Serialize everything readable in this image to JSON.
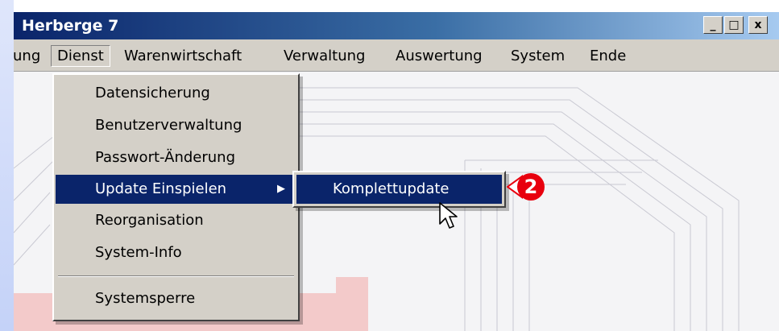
{
  "window": {
    "title": "Herberge 7",
    "controls": {
      "minimize": "_",
      "maximize": "□",
      "close": "x"
    }
  },
  "menubar": {
    "items": [
      {
        "label": "ung",
        "open": false
      },
      {
        "label": "Dienst",
        "open": true
      },
      {
        "label": "Warenwirtschaft",
        "open": false
      },
      {
        "label": "Verwaltung",
        "open": false
      },
      {
        "label": "Auswertung",
        "open": false
      },
      {
        "label": "System",
        "open": false
      },
      {
        "label": "Ende",
        "open": false
      }
    ]
  },
  "dienst_menu": {
    "items": [
      {
        "label": "Datensicherung"
      },
      {
        "label": "Benutzerverwaltung"
      },
      {
        "label": "Passwort-Änderung"
      },
      {
        "label": "Update Einspielen",
        "highlighted": true,
        "has_submenu": true
      },
      {
        "label": "Reorganisation"
      },
      {
        "label": "System-Info"
      },
      {
        "label": "Systemsperre"
      }
    ],
    "submenu_arrow": "▶"
  },
  "update_submenu": {
    "items": [
      {
        "label": "Komplettupdate",
        "highlighted": true
      }
    ]
  },
  "callout": {
    "number": "2",
    "color": "#e8000e"
  },
  "colors": {
    "titlebar_start": "#0a246a",
    "titlebar_end": "#a6caf0",
    "menu_face": "#d4d0c8",
    "highlight": "#0a246a"
  },
  "icons": {
    "cursor": "arrow-cursor-icon",
    "callout": "callout-arrow-icon"
  }
}
